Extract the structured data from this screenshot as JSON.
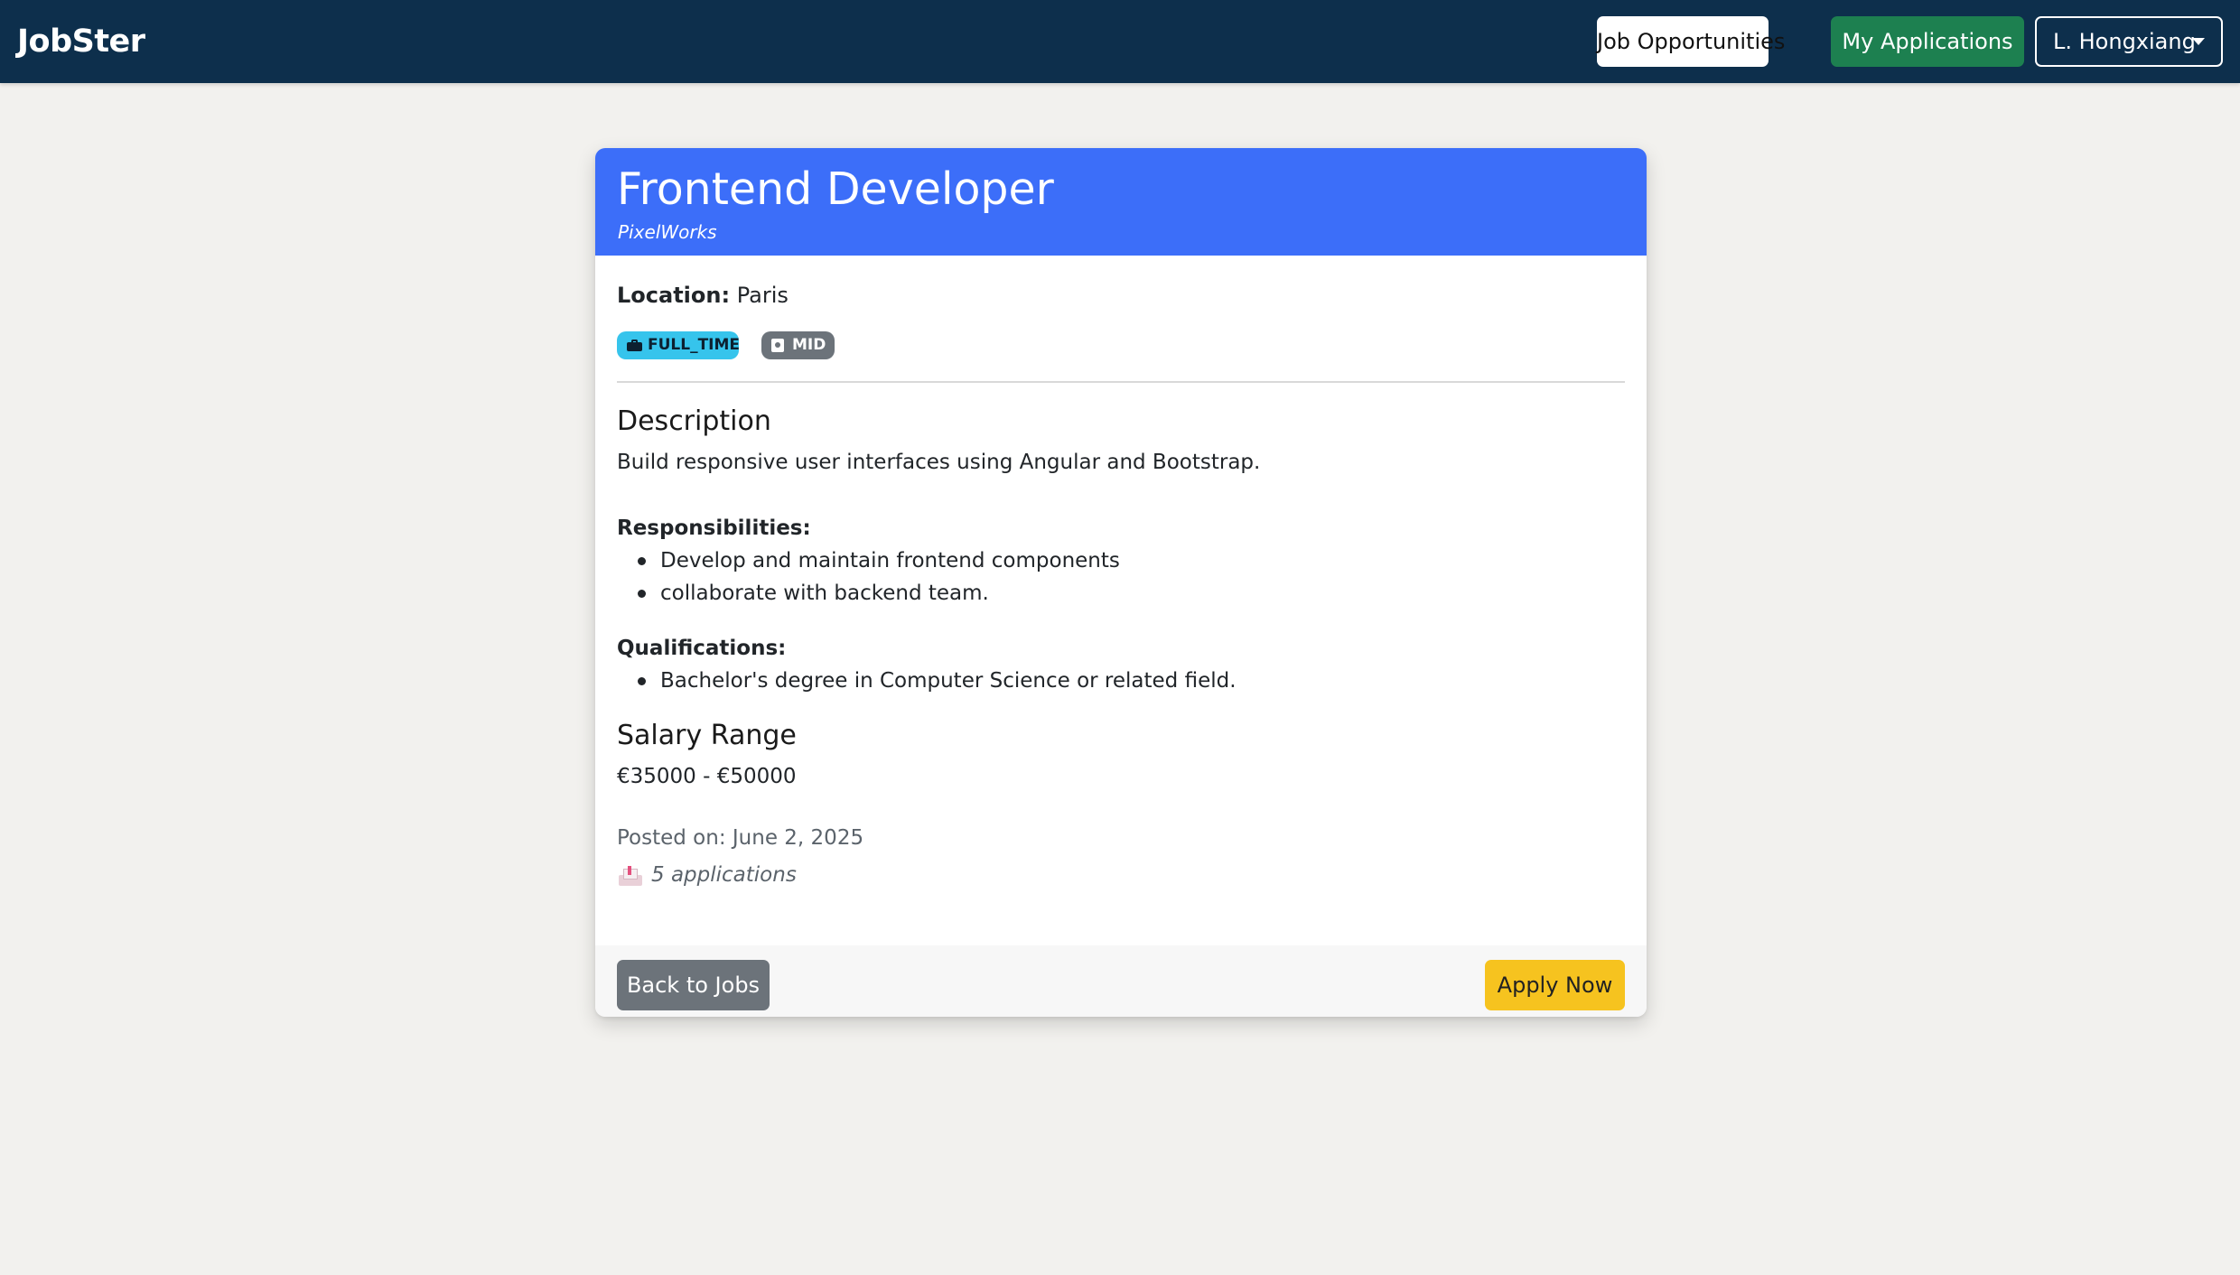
{
  "nav": {
    "brand": "JobSter",
    "job_opportunities": "Job Opportunities",
    "my_applications": "My Applications",
    "user_menu": "L. Hongxiang"
  },
  "job": {
    "title": "Frontend Developer",
    "company": "PixelWorks",
    "location_label": "Location:",
    "location": "Paris",
    "employment_type": "FULL_TIME",
    "level": "MID",
    "description_heading": "Description",
    "description": "Build responsive user interfaces using Angular and Bootstrap.",
    "responsibilities_heading": "Responsibilities:",
    "responsibilities": [
      "Develop and maintain frontend components",
      "collaborate with backend team."
    ],
    "qualifications_heading": "Qualifications:",
    "qualifications": [
      "Bachelor's degree in Computer Science or related field."
    ],
    "salary_heading": "Salary Range",
    "salary": "€35000 - €50000",
    "posted": "Posted on: June 2, 2025",
    "applications": "5 applications"
  },
  "actions": {
    "back": "Back to Jobs",
    "apply": "Apply Now"
  },
  "colors": {
    "navbar": "#0d2f4c",
    "card_header": "#3c6ef9",
    "my_applications_button": "#1d8050",
    "type_badge": "#36c4ec",
    "level_badge": "#6c737a",
    "apply_button": "#f6c31f",
    "back_button": "#6c737a"
  },
  "icons": {
    "type_badge": "briefcase-icon",
    "level_badge": "id-badge-icon",
    "applications": "inbox-tray-icon",
    "user_menu": "caret-down-icon"
  }
}
